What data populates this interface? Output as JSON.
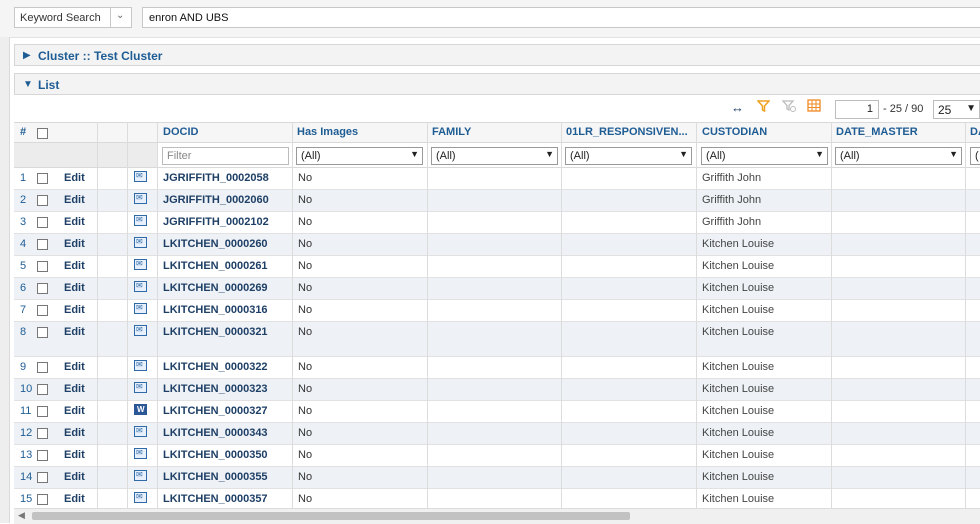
{
  "search": {
    "type_label": "Keyword Search",
    "query": "enron AND UBS"
  },
  "cluster_panel": {
    "title": "Cluster :: Test Cluster"
  },
  "list_panel": {
    "title": "List"
  },
  "pagination": {
    "current_page": "1",
    "range_text": "- 25 / 90",
    "page_size": "25"
  },
  "columns": {
    "num": "#",
    "docid": "DOCID",
    "has_images": "Has Images",
    "family": "FAMILY",
    "responsive": "01LR_RESPONSIVEN...",
    "custodian": "CUSTODIAN",
    "date_master": "DATE_MASTER",
    "next": "DA"
  },
  "filters": {
    "docid_placeholder": "Filter",
    "has_images": "(All)",
    "family": "(All)",
    "responsive": "(All)",
    "custodian": "(All)",
    "date_master": "(All)",
    "next": "("
  },
  "row_edit_label": "Edit",
  "rows": [
    {
      "num": "1",
      "docid": "JGRIFFITH_0002058",
      "has_images": "No",
      "custodian": "Griffith John",
      "icon": "email-icon"
    },
    {
      "num": "2",
      "docid": "JGRIFFITH_0002060",
      "has_images": "No",
      "custodian": "Griffith John",
      "icon": "email-icon"
    },
    {
      "num": "3",
      "docid": "JGRIFFITH_0002102",
      "has_images": "No",
      "custodian": "Griffith John",
      "icon": "email-icon"
    },
    {
      "num": "4",
      "docid": "LKITCHEN_0000260",
      "has_images": "No",
      "custodian": "Kitchen Louise",
      "icon": "email-icon"
    },
    {
      "num": "5",
      "docid": "LKITCHEN_0000261",
      "has_images": "No",
      "custodian": "Kitchen Louise",
      "icon": "email-icon"
    },
    {
      "num": "6",
      "docid": "LKITCHEN_0000269",
      "has_images": "No",
      "custodian": "Kitchen Louise",
      "icon": "email-icon"
    },
    {
      "num": "7",
      "docid": "LKITCHEN_0000316",
      "has_images": "No",
      "custodian": "Kitchen Louise",
      "icon": "email-icon"
    },
    {
      "num": "8",
      "docid": "LKITCHEN_0000321",
      "has_images": "No",
      "custodian": "Kitchen Louise",
      "icon": "email-icon"
    },
    {
      "num": "9",
      "docid": "LKITCHEN_0000322",
      "has_images": "No",
      "custodian": "Kitchen Louise",
      "icon": "email-icon"
    },
    {
      "num": "10",
      "docid": "LKITCHEN_0000323",
      "has_images": "No",
      "custodian": "Kitchen Louise",
      "icon": "email-icon"
    },
    {
      "num": "11",
      "docid": "LKITCHEN_0000327",
      "has_images": "No",
      "custodian": "Kitchen Louise",
      "icon": "word-doc-icon"
    },
    {
      "num": "12",
      "docid": "LKITCHEN_0000343",
      "has_images": "No",
      "custodian": "Kitchen Louise",
      "icon": "email-icon"
    },
    {
      "num": "13",
      "docid": "LKITCHEN_0000350",
      "has_images": "No",
      "custodian": "Kitchen Louise",
      "icon": "email-icon"
    },
    {
      "num": "14",
      "docid": "LKITCHEN_0000355",
      "has_images": "No",
      "custodian": "Kitchen Louise",
      "icon": "email-icon"
    },
    {
      "num": "15",
      "docid": "LKITCHEN_0000357",
      "has_images": "No",
      "custodian": "Kitchen Louise",
      "icon": "email-icon"
    }
  ],
  "toolbar_icons": [
    "expand-columns-icon",
    "filter-icon",
    "clear-filter-icon",
    "column-grid-icon"
  ],
  "colors": {
    "link": "#1e5c94",
    "filter_icon": "#f0a020",
    "grid_icon": "#f08a24"
  }
}
